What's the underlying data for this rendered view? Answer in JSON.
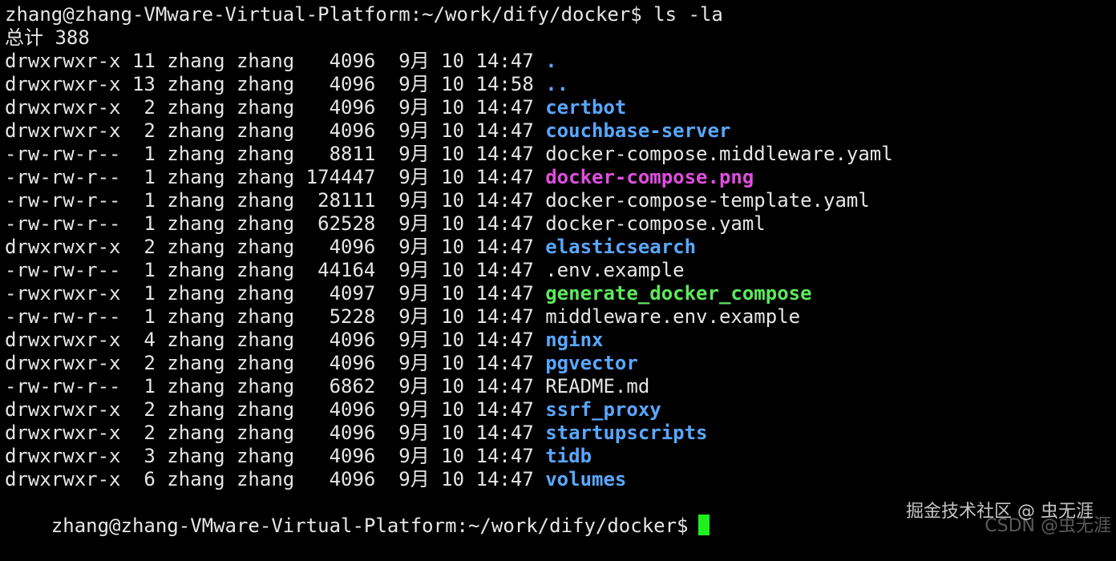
{
  "prompt": "zhang@zhang-VMware-Virtual-Platform:~/work/dify/docker$ ls -la",
  "total": "总计 388",
  "entries": [
    {
      "perms": "drwxrwxr-x",
      "links": "11",
      "user": "zhang",
      "group": "zhang",
      "size": "4096",
      "month": "9月",
      "day": "10",
      "time": "14:47",
      "name": ".",
      "color": "#5aa7ff",
      "bold": true
    },
    {
      "perms": "drwxrwxr-x",
      "links": "13",
      "user": "zhang",
      "group": "zhang",
      "size": "4096",
      "month": "9月",
      "day": "10",
      "time": "14:58",
      "name": "..",
      "color": "#5aa7ff",
      "bold": true
    },
    {
      "perms": "drwxrwxr-x",
      "links": "2",
      "user": "zhang",
      "group": "zhang",
      "size": "4096",
      "month": "9月",
      "day": "10",
      "time": "14:47",
      "name": "certbot",
      "color": "#5aa7ff",
      "bold": true
    },
    {
      "perms": "drwxrwxr-x",
      "links": "2",
      "user": "zhang",
      "group": "zhang",
      "size": "4096",
      "month": "9月",
      "day": "10",
      "time": "14:47",
      "name": "couchbase-server",
      "color": "#5aa7ff",
      "bold": true
    },
    {
      "perms": "-rw-rw-r--",
      "links": "1",
      "user": "zhang",
      "group": "zhang",
      "size": "8811",
      "month": "9月",
      "day": "10",
      "time": "14:47",
      "name": "docker-compose.middleware.yaml",
      "color": "#e6e6e6",
      "bold": false
    },
    {
      "perms": "-rw-rw-r--",
      "links": "1",
      "user": "zhang",
      "group": "zhang",
      "size": "174447",
      "month": "9月",
      "day": "10",
      "time": "14:47",
      "name": "docker-compose.png",
      "color": "#e04ee0",
      "bold": true
    },
    {
      "perms": "-rw-rw-r--",
      "links": "1",
      "user": "zhang",
      "group": "zhang",
      "size": "28111",
      "month": "9月",
      "day": "10",
      "time": "14:47",
      "name": "docker-compose-template.yaml",
      "color": "#e6e6e6",
      "bold": false
    },
    {
      "perms": "-rw-rw-r--",
      "links": "1",
      "user": "zhang",
      "group": "zhang",
      "size": "62528",
      "month": "9月",
      "day": "10",
      "time": "14:47",
      "name": "docker-compose.yaml",
      "color": "#e6e6e6",
      "bold": false
    },
    {
      "perms": "drwxrwxr-x",
      "links": "2",
      "user": "zhang",
      "group": "zhang",
      "size": "4096",
      "month": "9月",
      "day": "10",
      "time": "14:47",
      "name": "elasticsearch",
      "color": "#5aa7ff",
      "bold": true
    },
    {
      "perms": "-rw-rw-r--",
      "links": "1",
      "user": "zhang",
      "group": "zhang",
      "size": "44164",
      "month": "9月",
      "day": "10",
      "time": "14:47",
      "name": ".env.example",
      "color": "#e6e6e6",
      "bold": false
    },
    {
      "perms": "-rwxrwxr-x",
      "links": "1",
      "user": "zhang",
      "group": "zhang",
      "size": "4097",
      "month": "9月",
      "day": "10",
      "time": "14:47",
      "name": "generate_docker_compose",
      "color": "#5ee85e",
      "bold": true
    },
    {
      "perms": "-rw-rw-r--",
      "links": "1",
      "user": "zhang",
      "group": "zhang",
      "size": "5228",
      "month": "9月",
      "day": "10",
      "time": "14:47",
      "name": "middleware.env.example",
      "color": "#e6e6e6",
      "bold": false
    },
    {
      "perms": "drwxrwxr-x",
      "links": "4",
      "user": "zhang",
      "group": "zhang",
      "size": "4096",
      "month": "9月",
      "day": "10",
      "time": "14:47",
      "name": "nginx",
      "color": "#5aa7ff",
      "bold": true
    },
    {
      "perms": "drwxrwxr-x",
      "links": "2",
      "user": "zhang",
      "group": "zhang",
      "size": "4096",
      "month": "9月",
      "day": "10",
      "time": "14:47",
      "name": "pgvector",
      "color": "#5aa7ff",
      "bold": true
    },
    {
      "perms": "-rw-rw-r--",
      "links": "1",
      "user": "zhang",
      "group": "zhang",
      "size": "6862",
      "month": "9月",
      "day": "10",
      "time": "14:47",
      "name": "README.md",
      "color": "#e6e6e6",
      "bold": false
    },
    {
      "perms": "drwxrwxr-x",
      "links": "2",
      "user": "zhang",
      "group": "zhang",
      "size": "4096",
      "month": "9月",
      "day": "10",
      "time": "14:47",
      "name": "ssrf_proxy",
      "color": "#5aa7ff",
      "bold": true
    },
    {
      "perms": "drwxrwxr-x",
      "links": "2",
      "user": "zhang",
      "group": "zhang",
      "size": "4096",
      "month": "9月",
      "day": "10",
      "time": "14:47",
      "name": "startupscripts",
      "color": "#5aa7ff",
      "bold": true
    },
    {
      "perms": "drwxrwxr-x",
      "links": "3",
      "user": "zhang",
      "group": "zhang",
      "size": "4096",
      "month": "9月",
      "day": "10",
      "time": "14:47",
      "name": "tidb",
      "color": "#5aa7ff",
      "bold": true
    },
    {
      "perms": "drwxrwxr-x",
      "links": "6",
      "user": "zhang",
      "group": "zhang",
      "size": "4096",
      "month": "9月",
      "day": "10",
      "time": "14:47",
      "name": "volumes",
      "color": "#5aa7ff",
      "bold": true
    }
  ],
  "final_prompt": "zhang@zhang-VMware-Virtual-Platform:~/work/dify/docker$",
  "cursor_color": "#1ef01e",
  "watermark": "掘金技术社区 @ 虫无涯",
  "watermark2": "CSDN @虫无涯"
}
